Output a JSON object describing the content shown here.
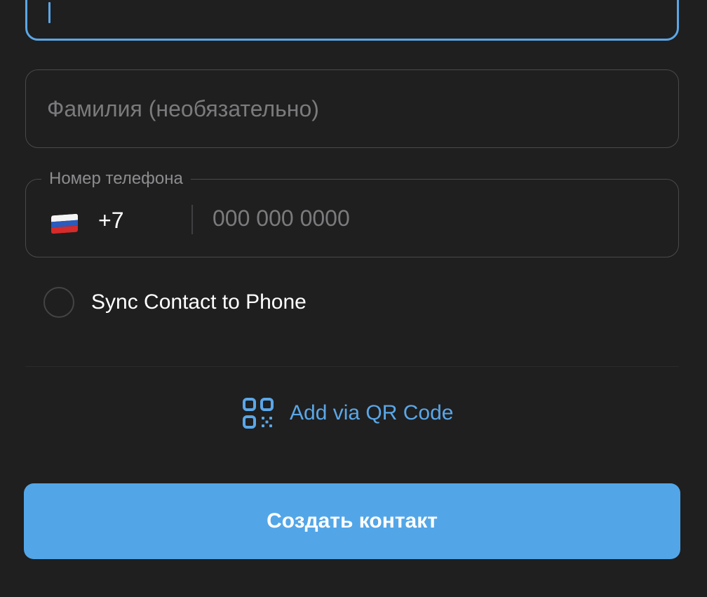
{
  "form": {
    "first_name": {
      "value": ""
    },
    "last_name": {
      "placeholder": "Фамилия (необязательно)",
      "value": ""
    },
    "phone": {
      "legend": "Номер телефона",
      "country_flag": "russia-flag-icon",
      "country_code": "+7",
      "placeholder": "000 000 0000",
      "value": ""
    },
    "sync": {
      "label": "Sync Contact to Phone",
      "checked": false
    }
  },
  "qr": {
    "label": "Add via QR Code",
    "icon": "qr-code-icon"
  },
  "submit": {
    "label": "Создать контакт"
  },
  "colors": {
    "background": "#1f1f1f",
    "accent": "#5aa7e8",
    "button": "#52a6e8",
    "border": "#4a4a4c",
    "placeholder": "#7b7b7e"
  }
}
